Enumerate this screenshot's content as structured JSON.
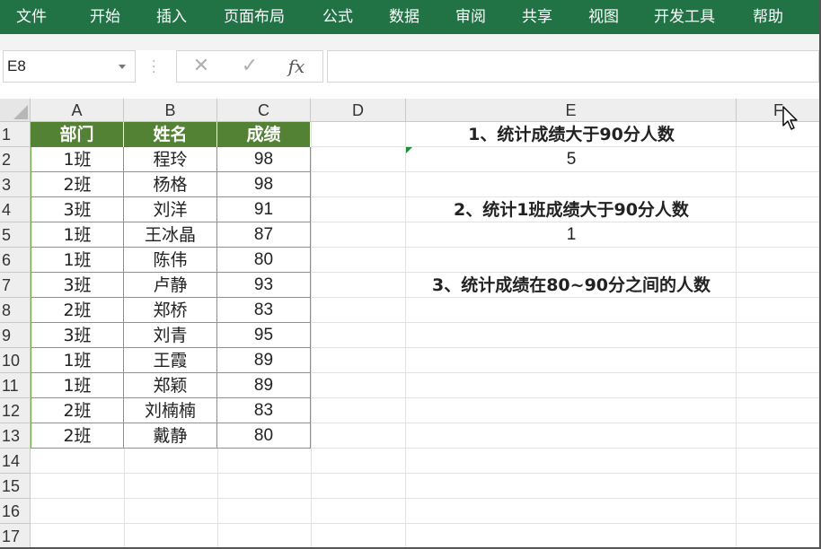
{
  "ribbon": {
    "tabs": [
      "文件",
      "开始",
      "插入",
      "页面布局",
      "公式",
      "数据",
      "审阅",
      "共享",
      "视图",
      "开发工具",
      "帮助"
    ]
  },
  "formula_bar": {
    "name_box": "E8",
    "cancel_icon": "✕",
    "enter_icon": "✓",
    "fx_label": "fx",
    "formula": ""
  },
  "sheet": {
    "columns": [
      "A",
      "B",
      "C",
      "D",
      "E",
      "F"
    ],
    "rows": [
      "1",
      "2",
      "3",
      "4",
      "5",
      "6",
      "7",
      "8",
      "9",
      "10",
      "11",
      "12",
      "13",
      "14",
      "15",
      "16",
      "17"
    ],
    "table_header": [
      "部门",
      "姓名",
      "成绩"
    ],
    "table_rows": [
      [
        "1班",
        "程玲",
        "98"
      ],
      [
        "2班",
        "杨格",
        "98"
      ],
      [
        "3班",
        "刘洋",
        "91"
      ],
      [
        "1班",
        "王冰晶",
        "87"
      ],
      [
        "1班",
        "陈伟",
        "80"
      ],
      [
        "3班",
        "卢静",
        "93"
      ],
      [
        "2班",
        "郑桥",
        "83"
      ],
      [
        "3班",
        "刘青",
        "95"
      ],
      [
        "1班",
        "王霞",
        "89"
      ],
      [
        "1班",
        "郑颖",
        "89"
      ],
      [
        "2班",
        "刘楠楠",
        "83"
      ],
      [
        "2班",
        "戴静",
        "80"
      ]
    ],
    "questions": [
      {
        "question": "1、统计成绩大于90分人数",
        "answer": "5"
      },
      {
        "question": "2、统计1班成绩大于90分人数",
        "answer": "1"
      },
      {
        "question": "3、统计成绩在80~90分之间的人数",
        "answer": ""
      }
    ]
  },
  "colors": {
    "ribbon": "#217346",
    "table_header": "#548235",
    "table_border": "#70ad47"
  }
}
